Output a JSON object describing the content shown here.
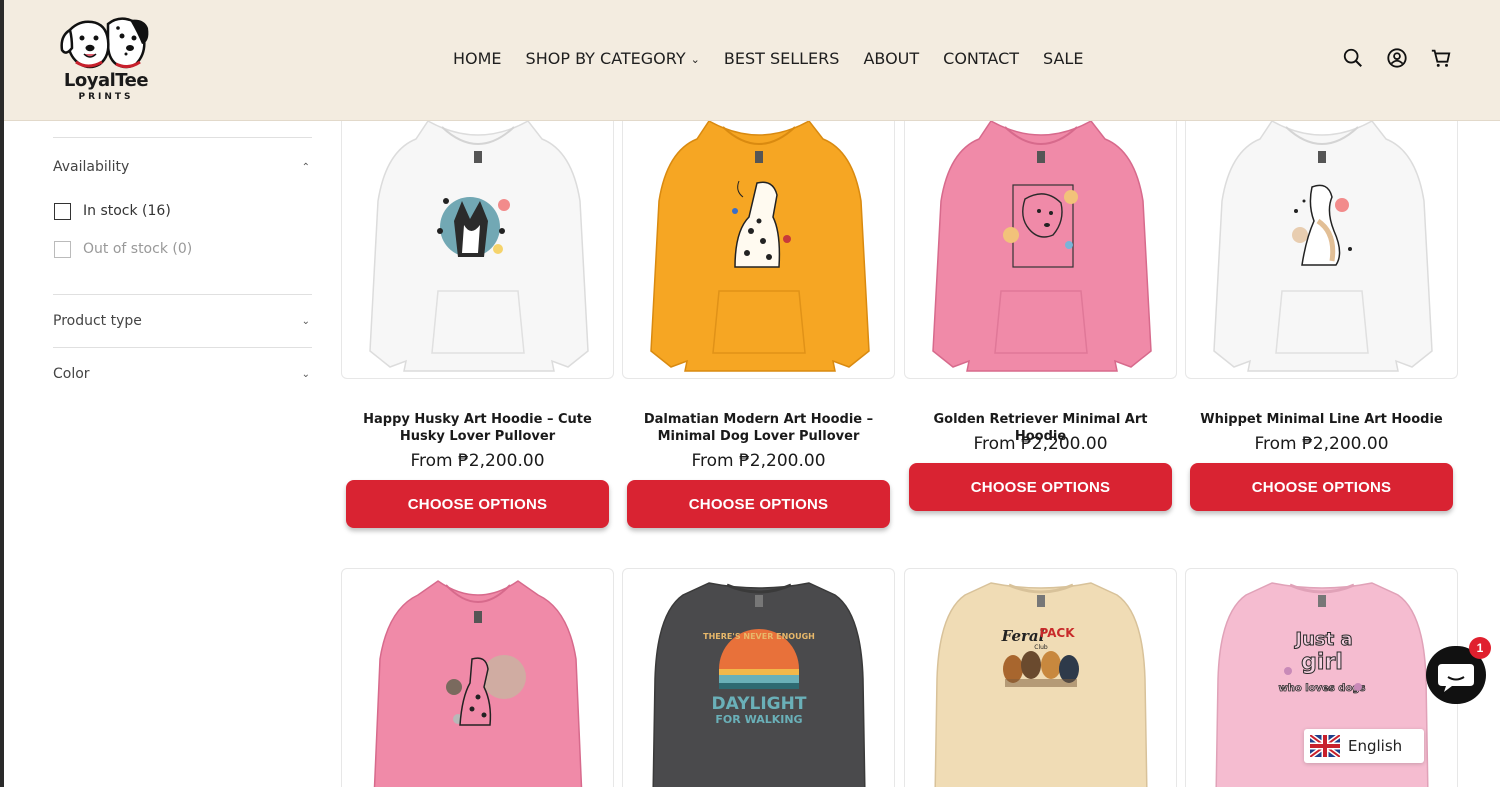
{
  "brand": {
    "name": "LoyalTee",
    "sub": "PRINTS"
  },
  "nav": [
    {
      "label": "HOME"
    },
    {
      "label": "SHOP BY CATEGORY",
      "has_dropdown": true
    },
    {
      "label": "BEST SELLERS"
    },
    {
      "label": "ABOUT"
    },
    {
      "label": "CONTACT"
    },
    {
      "label": "SALE"
    }
  ],
  "header_icons": [
    "search-icon",
    "account-icon",
    "cart-icon"
  ],
  "filters": {
    "availability": {
      "label": "Availability",
      "options": [
        {
          "label": "In stock (16)",
          "enabled": true
        },
        {
          "label": "Out of stock (0)",
          "enabled": false
        }
      ]
    },
    "product_type": {
      "label": "Product type"
    },
    "color": {
      "label": "Color"
    }
  },
  "products": [
    {
      "title": "Happy Husky Art Hoodie – Cute Husky Lover Pullover",
      "price": "From ₱2,200.00",
      "button": "CHOOSE OPTIONS",
      "garment_color": "#f7f7f7"
    },
    {
      "title": "Dalmatian Modern Art Hoodie – Minimal Dog Lover Pullover",
      "price": "From ₱2,200.00",
      "button": "CHOOSE OPTIONS",
      "garment_color": "#f6a623"
    },
    {
      "title": "Golden Retriever Minimal Art Hoodie",
      "price": "From ₱2,200.00",
      "button": "CHOOSE OPTIONS",
      "garment_color": "#f08aa8"
    },
    {
      "title": "Whippet Minimal Line Art Hoodie",
      "price": "From ₱2,200.00",
      "button": "CHOOSE OPTIONS",
      "garment_color": "#f7f7f7"
    }
  ],
  "row2_products": [
    {
      "garment_color": "#f08aa8",
      "graphic": "dalmatian"
    },
    {
      "garment_color": "#4a4a4c",
      "graphic_text_top": "THERE'S NEVER ENOUGH",
      "graphic_text_main": "DAYLIGHT",
      "graphic_text_sub": "FOR WALKING"
    },
    {
      "garment_color": "#f0dcb5",
      "graphic_text_top": "Feral",
      "graphic_text_main": "PACK",
      "graphic_text_sub": "Club"
    },
    {
      "garment_color": "#f5bcd0",
      "graphic_text_top": "Just a",
      "graphic_text_main": "girl",
      "graphic_text_sub": "who loves dogs"
    }
  ],
  "chat": {
    "badge": "1"
  },
  "language": {
    "label": "English"
  },
  "colors": {
    "accent": "#d92332",
    "header_bg": "#f3ece0"
  }
}
